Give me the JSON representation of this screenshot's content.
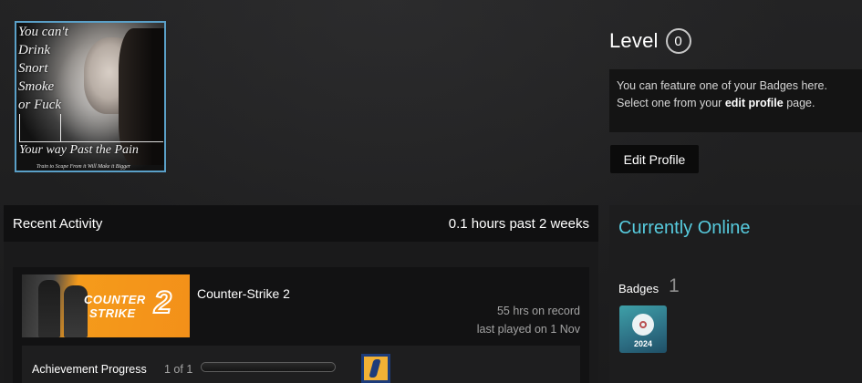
{
  "avatar": {
    "lines": [
      "You can't",
      "Drink",
      "Snort",
      "Smoke",
      "or Fuck"
    ],
    "caption": "Your way Past the Pain",
    "fine_print": "Train to Scape From it Will Make it Bigger"
  },
  "level": {
    "label": "Level",
    "value": "0"
  },
  "badge_feature": {
    "line1": "You can feature one of your Badges here.",
    "line2_prefix": "Select one from your ",
    "line2_link": "edit profile",
    "line2_suffix": " page."
  },
  "edit_profile_button": "Edit Profile",
  "recent_activity": {
    "title": "Recent Activity",
    "hours_summary": "0.1 hours past 2 weeks",
    "games": [
      {
        "name": "Counter-Strike 2",
        "capsule_line1": "COUNTER",
        "capsule_line2": "STRIKE",
        "capsule_num": "2",
        "hours_on_record": "55 hrs on record",
        "last_played": "last played on 1 Nov",
        "achievement_label": "Achievement Progress",
        "achievement_count": "1 of 1",
        "achievement_fraction": 1.0
      }
    ]
  },
  "sidebar": {
    "status": "Currently Online",
    "badges_label": "Badges",
    "badges_count": "1",
    "badge_year": "2024"
  },
  "colors": {
    "online": "#57cbde",
    "avatar_border": "#5aa0c8",
    "background": "#1e1e1f"
  }
}
